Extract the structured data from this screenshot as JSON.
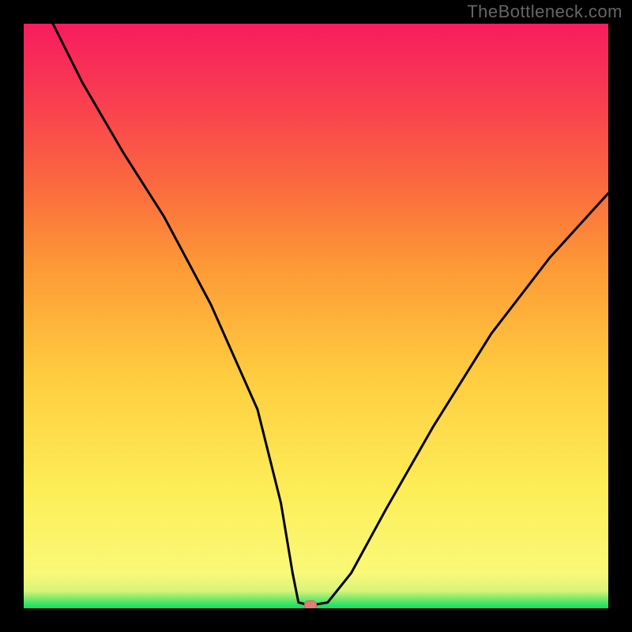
{
  "watermark": "TheBottleneck.com",
  "chart_data": {
    "type": "line",
    "title": "",
    "xlabel": "",
    "ylabel": "",
    "x_range": [
      0,
      100
    ],
    "y_range": [
      0,
      100
    ],
    "grid": false,
    "legend": false,
    "series": [
      {
        "name": "bottleneck-curve",
        "color": "#000000",
        "x": [
          5,
          10,
          17,
          24,
          32,
          40,
          44,
          46,
          47,
          49,
          52,
          56,
          62,
          70,
          80,
          90,
          100
        ],
        "y": [
          100,
          90,
          78,
          67,
          52,
          34,
          18,
          6,
          1,
          0.5,
          1,
          6,
          17,
          31,
          47,
          60,
          71
        ]
      }
    ],
    "marker": {
      "x": 49,
      "y": 0.5,
      "color": "#e47b7a"
    },
    "background_gradient": {
      "stops": [
        {
          "pos": 0,
          "color": "#09e060"
        },
        {
          "pos": 3,
          "color": "#d9f47a"
        },
        {
          "pos": 20,
          "color": "#fdee58"
        },
        {
          "pos": 40,
          "color": "#fecc3f"
        },
        {
          "pos": 58,
          "color": "#fd9b36"
        },
        {
          "pos": 72,
          "color": "#fb6b3e"
        },
        {
          "pos": 85,
          "color": "#f9434e"
        },
        {
          "pos": 100,
          "color": "#f71c5f"
        }
      ]
    }
  }
}
